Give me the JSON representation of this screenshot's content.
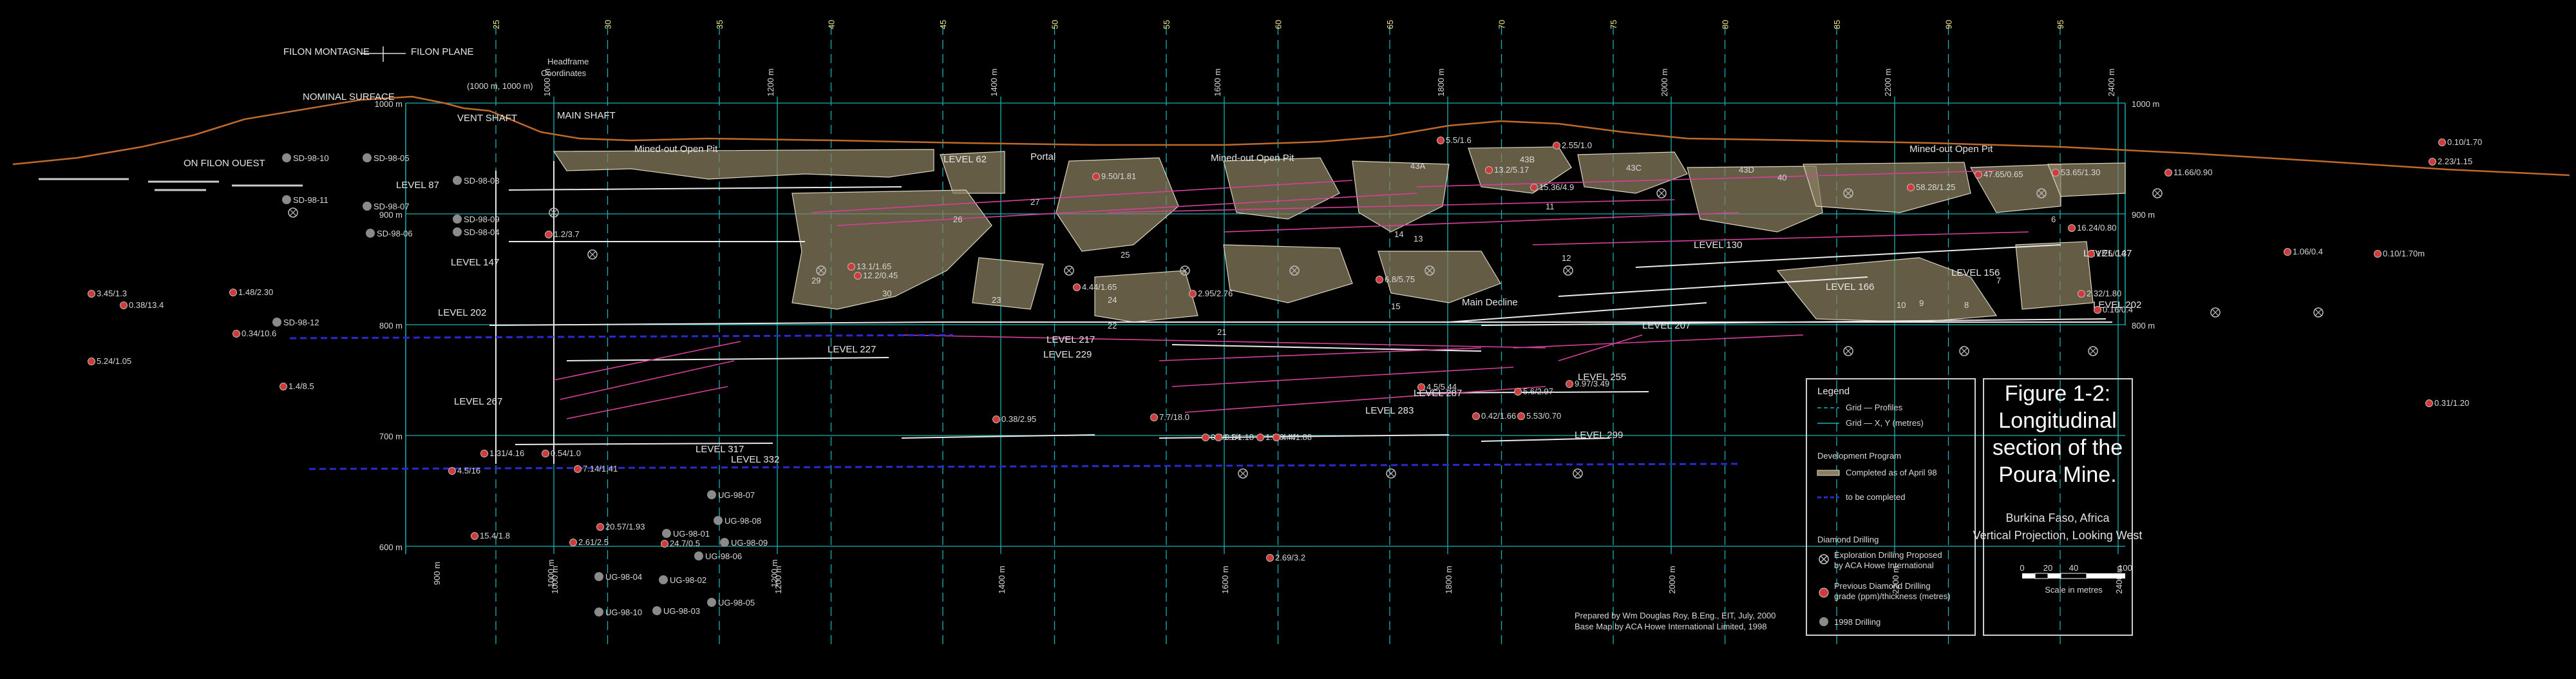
{
  "header": {
    "filon_montagne": "FILON MONTAGNE",
    "filon_plane": "FILON PLANE",
    "nominal_surface": "NOMINAL SURFACE",
    "headframe": [
      "Headframe",
      "Coordinates",
      "(1000 m, 1000 m)"
    ],
    "vent_shaft": "VENT SHAFT",
    "main_shaft": "MAIN SHAFT",
    "on_filon_ouest": "ON FILON OUEST"
  },
  "grid": {
    "top_numbers": [
      "25",
      "30",
      "35",
      "40",
      "45",
      "50",
      "55",
      "60",
      "65",
      "70",
      "75",
      "80",
      "85",
      "90",
      "95"
    ],
    "x_labels": [
      "1000 m",
      "1200 m",
      "1400 m",
      "1600 m",
      "1800 m",
      "2000 m",
      "2200 m",
      "2400 m"
    ],
    "left_x_labels": [
      "900 m",
      "1000 m",
      "1200 m"
    ],
    "y_labels": [
      "1000 m",
      "900 m",
      "800 m",
      "700 m",
      "600 m"
    ],
    "right_y_labels": [
      "1000 m",
      "900 m",
      "800 m"
    ]
  },
  "areas": {
    "mined_out_1": "Mined-out Open Pit",
    "mined_out_2": "Mined-out Open Pit",
    "mined_out_3": "Mined-out Open Pit",
    "portal": "Portal",
    "main_decline": "Main Decline"
  },
  "levels": [
    "LEVEL 87",
    "LEVEL 147",
    "LEVEL 202",
    "LEVEL 62",
    "LEVEL 227",
    "LEVEL 229",
    "LEVEL 217",
    "LEVEL 267",
    "LEVEL 317",
    "LEVEL 332",
    "LEVEL 283",
    "LEVEL 287",
    "LEVEL 255",
    "LEVEL 299",
    "LEVEL 130",
    "LEVEL 166",
    "LEVEL 156",
    "LEVEL 147",
    "LEVEL 207",
    "LEVEL 202"
  ],
  "holes_1998": [
    "SD-98-10",
    "SD-98-05",
    "SD-98-11",
    "SD-98-07",
    "SD-98-06",
    "SD-98-12",
    "SD-98-03",
    "SD-98-09",
    "SD-98-04",
    "UG-98-07",
    "UG-98-08",
    "UG-98-01",
    "UG-98-09",
    "UG-98-06",
    "UG-98-04",
    "UG-98-02",
    "UG-98-10",
    "UG-98-03",
    "UG-98-05"
  ],
  "grades": [
    "3.45/1.3",
    "0.38/13.4",
    "1.48/2.30",
    "0.34/10.6",
    "5.24/1.05",
    "1.4/8.5",
    "15.4/1.8",
    "2.61/2.5",
    "20.57/1.93",
    "24.7/0.5",
    "4.5/16",
    "1.31/4.16",
    "0.54/1.0",
    "7.14/1.41",
    "1.2/3.7",
    "12.2/0.45",
    "13.1/1.65",
    "4.44/1.65",
    "2.95/2.76",
    "6.8/5.75",
    "7.7/18.0",
    "0.5/0.84",
    "1.1/1.18",
    "1.7/0.44",
    "4.4/1.88",
    "4.5/5.44",
    "0.42/1.66",
    "5.53/0.70",
    "5.6/2.97",
    "9.97/3.49",
    "0.38/2.95",
    "2.69/3.2",
    "11.66/0.90",
    "1.25/0.3",
    "1.06/0.4",
    "0.10/1.70m",
    "0.31/1.20",
    "0.10/1.70",
    "2.23/1.15",
    "16.24/0.80",
    "47.65/0.65",
    "53.65/1.30",
    "58.28/1.25",
    "2.32/1.80",
    "0.16/0.4",
    "15.36/4.9",
    "2.55/1.0",
    "5.5/1.6",
    "13.2/5.17",
    "9.50/1.81"
  ],
  "stope_numbers": [
    "27",
    "26",
    "25",
    "24",
    "23",
    "22",
    "21",
    "30",
    "29",
    "15",
    "14",
    "13",
    "12",
    "11",
    "10",
    "9",
    "8",
    "7",
    "6",
    "43A",
    "43B",
    "43C",
    "43D",
    "40"
  ],
  "legend": {
    "title": "Legend",
    "grid_profiles": "Grid — Profiles",
    "grid_xy": "Grid — X, Y (metres)",
    "dev_program": "Development Program",
    "completed": "Completed as of April 98",
    "to_complete": "to be completed",
    "diamond_drilling": "Diamond Drilling",
    "proposed": [
      "Exploration Drilling Proposed",
      "by ACA Howe International"
    ],
    "previous": [
      "Previous Diamond Drilling",
      "grade (ppm)/thickness (metres)"
    ],
    "drilling_1998": "1998 Drilling"
  },
  "title_block": {
    "figure": "Figure 1-2:",
    "lines": [
      "Longitudinal",
      "section of the",
      "Poura Mine."
    ],
    "location": "Burkina Faso, Africa",
    "projection": "Vertical Projection, Looking West",
    "scale_ticks": [
      "0",
      "20",
      "40",
      "100"
    ],
    "scale_caption": "Scale in metres"
  },
  "credits": {
    "prepared": "Prepared by Wm Douglas Roy, B.Eng., EIT, July, 2000",
    "base_map": "Base Map by ACA Howe International Limited, 1998"
  },
  "colors": {
    "grid": "#19b3b3",
    "stope": "#8a8060",
    "drill": "#d6409a",
    "terrain": "#c06a2a",
    "decline": "#2a2ad0",
    "red_dot": "#d23a3a"
  }
}
